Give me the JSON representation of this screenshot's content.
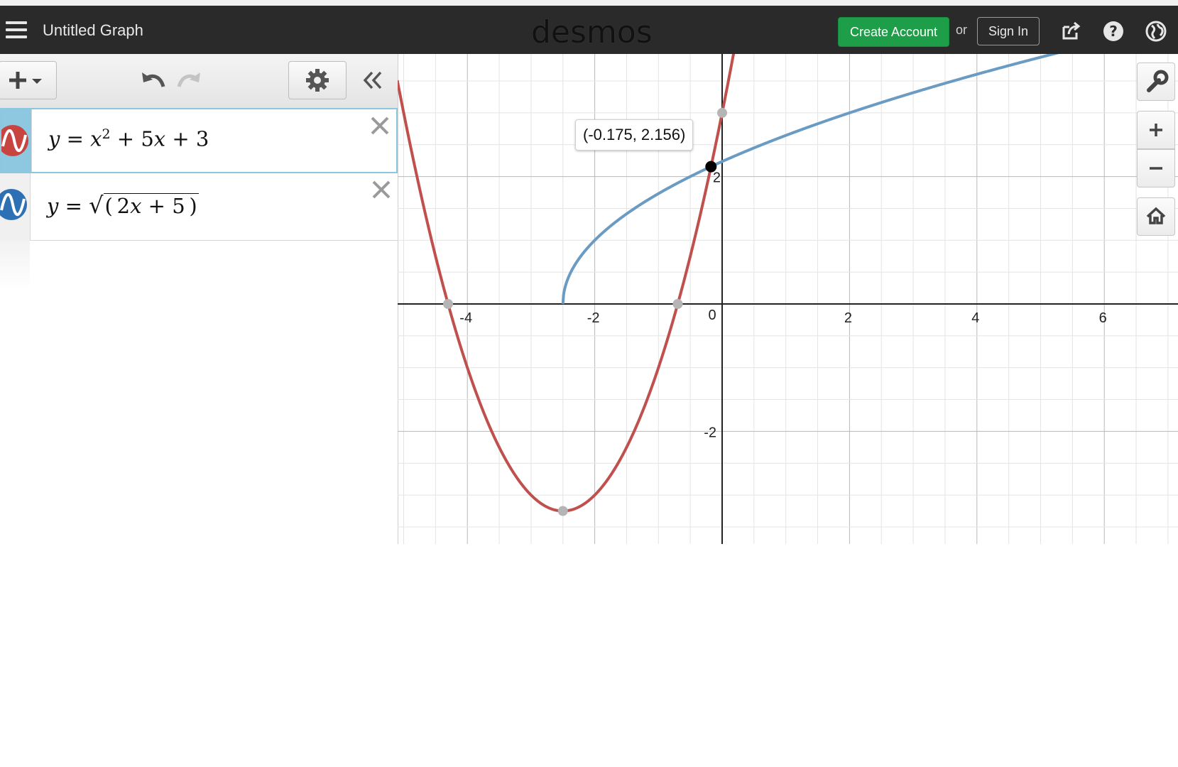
{
  "header": {
    "title": "Untitled Graph",
    "logo": "desmos",
    "create_account": "Create Account",
    "or": "or",
    "sign_in": "Sign In"
  },
  "toolbar": {
    "add_icon": "plus-dropdown-icon",
    "undo_icon": "undo-icon",
    "redo_icon": "redo-icon",
    "settings_icon": "gear-icon",
    "collapse_icon": "double-chevron-left-icon"
  },
  "expressions": [
    {
      "latex": "y = x^2 + 5x + 3",
      "color": "#c74440",
      "active": true
    },
    {
      "latex": "y = sqrt((2x + 5))",
      "color": "#2d70b3",
      "active": false
    }
  ],
  "graph": {
    "x_ticks": [
      "-4",
      "-2",
      "0",
      "2",
      "4",
      "6"
    ],
    "y_ticks": [
      "2",
      "-2"
    ],
    "point_label": "(-0.175, 2.156)",
    "series_colors": {
      "parabola": "#c0504d",
      "sqrt": "#6a9bc3"
    }
  },
  "chart_data": {
    "type": "line",
    "xlim": [
      -5.1,
      7.2
    ],
    "ylim": [
      -3.8,
      3.8
    ],
    "grid": true,
    "series": [
      {
        "expression": "y = x^2 + 5x + 3",
        "function": "x^2+5x+3"
      },
      {
        "expression": "y = sqrt(2x + 5)",
        "function": "sqrt(2x+5)"
      }
    ],
    "highlighted_point": {
      "x": -0.175,
      "y": 2.156
    },
    "marked_points": [
      {
        "x": -4.303,
        "y": 0
      },
      {
        "x": -0.697,
        "y": 0
      },
      {
        "x": 0,
        "y": 3
      },
      {
        "x": -2.5,
        "y": -3.25
      }
    ]
  },
  "side_controls": {
    "wrench_icon": "wrench-icon",
    "zoom_in_icon": "plus-icon",
    "zoom_out_icon": "minus-icon",
    "home_icon": "home-icon"
  }
}
